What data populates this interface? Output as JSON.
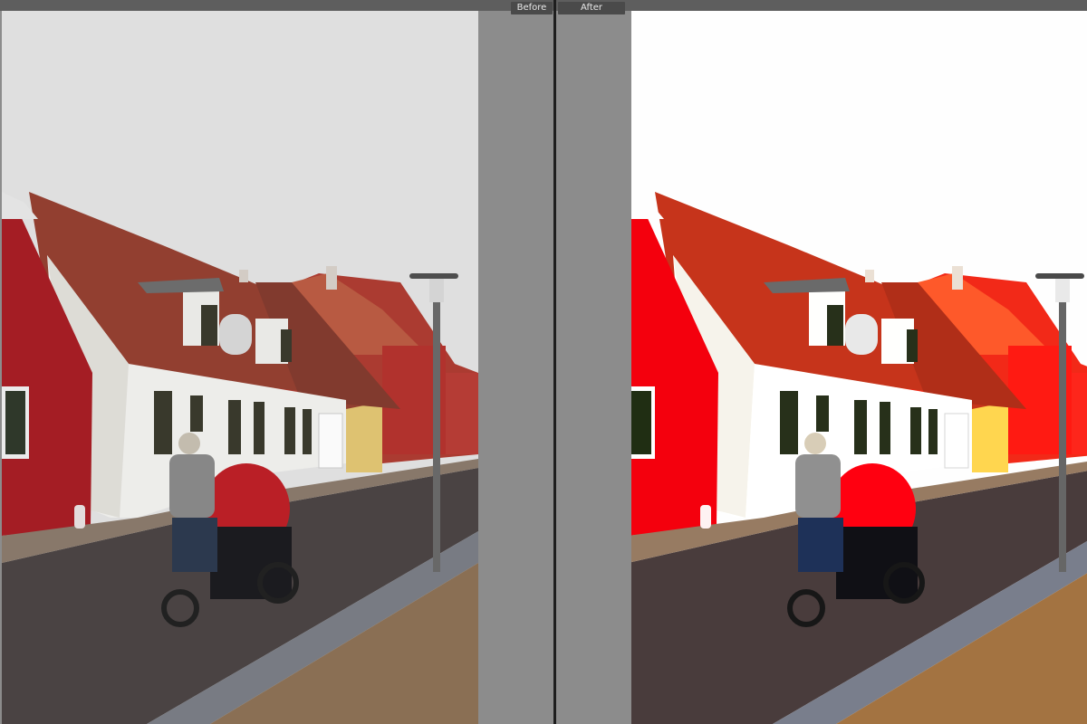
{
  "view": {
    "before_label": "Before",
    "after_label": "After"
  },
  "photo": {
    "description_icon": "photo-street-scene",
    "colors": {
      "sky": "#e6e6e6",
      "red_house": "#b51c24",
      "roof": "#a0412e",
      "white_house": "#f3f3f0",
      "road": "#4e4645",
      "sidewalk": "#8f7256",
      "cobbles": "#7d8088",
      "cart_red": "#cc1c24"
    }
  }
}
